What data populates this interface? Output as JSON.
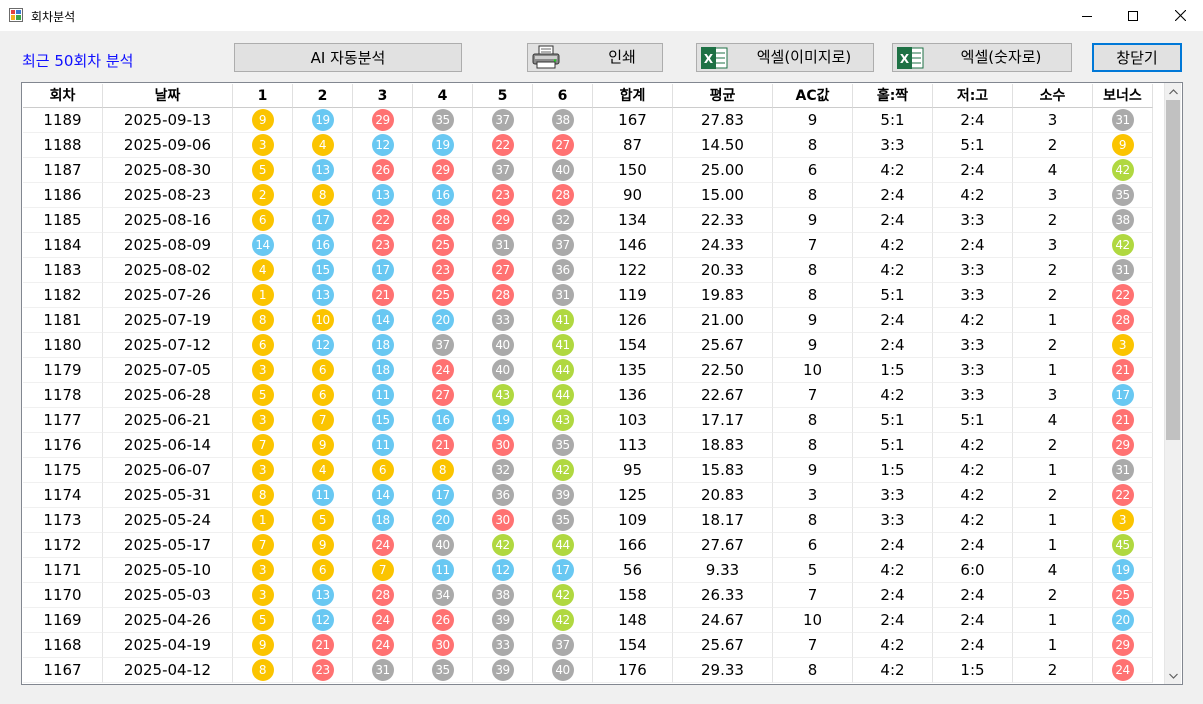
{
  "window": {
    "title": "회차분석"
  },
  "caption": "최근 50회차 분석",
  "toolbar": {
    "ai_label": "AI 자동분석",
    "print_label": "인쇄",
    "excel_image_label": "엑셀(이미지로)",
    "excel_number_label": "엑셀(숫자로)",
    "close_label": "창닫기"
  },
  "ball_colors": {
    "yellow": "#fbc400",
    "blue": "#69c8f2",
    "red": "#ff7272",
    "gray": "#aaaaaa",
    "green": "#b0d840"
  },
  "columns": [
    "회차",
    "날짜",
    "1",
    "2",
    "3",
    "4",
    "5",
    "6",
    "합계",
    "평균",
    "AC값",
    "홀:짝",
    "저:고",
    "소수",
    "보너스"
  ],
  "rows": [
    [
      "1189",
      "2025-09-13",
      9,
      19,
      29,
      35,
      37,
      38,
      "167",
      "27.83",
      "9",
      "5:1",
      "2:4",
      "3",
      31
    ],
    [
      "1188",
      "2025-09-06",
      3,
      4,
      12,
      19,
      22,
      27,
      "87",
      "14.50",
      "8",
      "3:3",
      "5:1",
      "2",
      9
    ],
    [
      "1187",
      "2025-08-30",
      5,
      13,
      26,
      29,
      37,
      40,
      "150",
      "25.00",
      "6",
      "4:2",
      "2:4",
      "4",
      42
    ],
    [
      "1186",
      "2025-08-23",
      2,
      8,
      13,
      16,
      23,
      28,
      "90",
      "15.00",
      "8",
      "2:4",
      "4:2",
      "3",
      35
    ],
    [
      "1185",
      "2025-08-16",
      6,
      17,
      22,
      28,
      29,
      32,
      "134",
      "22.33",
      "9",
      "2:4",
      "3:3",
      "2",
      38
    ],
    [
      "1184",
      "2025-08-09",
      14,
      16,
      23,
      25,
      31,
      37,
      "146",
      "24.33",
      "7",
      "4:2",
      "2:4",
      "3",
      42
    ],
    [
      "1183",
      "2025-08-02",
      4,
      15,
      17,
      23,
      27,
      36,
      "122",
      "20.33",
      "8",
      "4:2",
      "3:3",
      "2",
      31
    ],
    [
      "1182",
      "2025-07-26",
      1,
      13,
      21,
      25,
      28,
      31,
      "119",
      "19.83",
      "8",
      "5:1",
      "3:3",
      "2",
      22
    ],
    [
      "1181",
      "2025-07-19",
      8,
      10,
      14,
      20,
      33,
      41,
      "126",
      "21.00",
      "9",
      "2:4",
      "4:2",
      "1",
      28
    ],
    [
      "1180",
      "2025-07-12",
      6,
      12,
      18,
      37,
      40,
      41,
      "154",
      "25.67",
      "9",
      "2:4",
      "3:3",
      "2",
      3
    ],
    [
      "1179",
      "2025-07-05",
      3,
      6,
      18,
      24,
      40,
      44,
      "135",
      "22.50",
      "10",
      "1:5",
      "3:3",
      "1",
      21
    ],
    [
      "1178",
      "2025-06-28",
      5,
      6,
      11,
      27,
      43,
      44,
      "136",
      "22.67",
      "7",
      "4:2",
      "3:3",
      "3",
      17
    ],
    [
      "1177",
      "2025-06-21",
      3,
      7,
      15,
      16,
      19,
      43,
      "103",
      "17.17",
      "8",
      "5:1",
      "5:1",
      "4",
      21
    ],
    [
      "1176",
      "2025-06-14",
      7,
      9,
      11,
      21,
      30,
      35,
      "113",
      "18.83",
      "8",
      "5:1",
      "4:2",
      "2",
      29
    ],
    [
      "1175",
      "2025-06-07",
      3,
      4,
      6,
      8,
      32,
      42,
      "95",
      "15.83",
      "9",
      "1:5",
      "4:2",
      "1",
      31
    ],
    [
      "1174",
      "2025-05-31",
      8,
      11,
      14,
      17,
      36,
      39,
      "125",
      "20.83",
      "3",
      "3:3",
      "4:2",
      "2",
      22
    ],
    [
      "1173",
      "2025-05-24",
      1,
      5,
      18,
      20,
      30,
      35,
      "109",
      "18.17",
      "8",
      "3:3",
      "4:2",
      "1",
      3
    ],
    [
      "1172",
      "2025-05-17",
      7,
      9,
      24,
      40,
      42,
      44,
      "166",
      "27.67",
      "6",
      "2:4",
      "2:4",
      "1",
      45
    ],
    [
      "1171",
      "2025-05-10",
      3,
      6,
      7,
      11,
      12,
      17,
      "56",
      "9.33",
      "5",
      "4:2",
      "6:0",
      "4",
      19
    ],
    [
      "1170",
      "2025-05-03",
      3,
      13,
      28,
      34,
      38,
      42,
      "158",
      "26.33",
      "7",
      "2:4",
      "2:4",
      "2",
      25
    ],
    [
      "1169",
      "2025-04-26",
      5,
      12,
      24,
      26,
      39,
      42,
      "148",
      "24.67",
      "10",
      "2:4",
      "2:4",
      "1",
      20
    ],
    [
      "1168",
      "2025-04-19",
      9,
      21,
      24,
      30,
      33,
      37,
      "154",
      "25.67",
      "7",
      "4:2",
      "2:4",
      "1",
      29
    ],
    [
      "1167",
      "2025-04-12",
      8,
      23,
      31,
      35,
      39,
      40,
      "176",
      "29.33",
      "8",
      "4:2",
      "1:5",
      "2",
      24
    ]
  ]
}
